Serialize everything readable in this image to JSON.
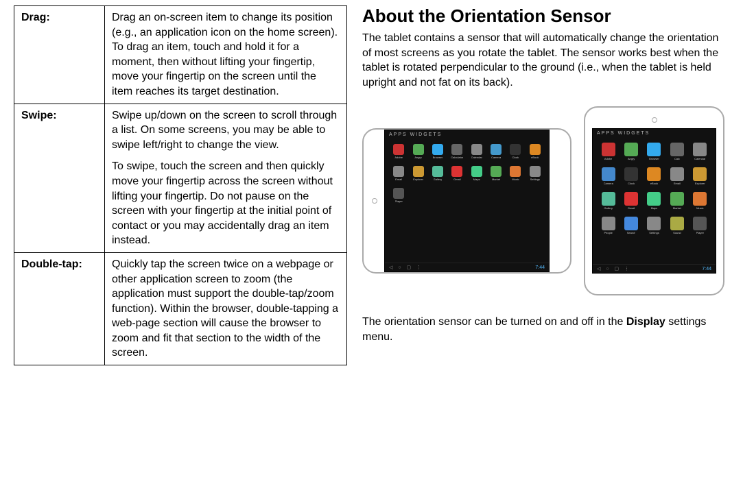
{
  "gestures": [
    {
      "label": "Drag:",
      "paragraphs": [
        "Drag an on-screen item to change its position (e.g., an application icon on the home screen).\nTo drag an item, touch and hold it for a moment, then without lifting your fingertip, move your fingertip on the screen until the item reaches its target destination."
      ]
    },
    {
      "label": "Swipe:",
      "paragraphs": [
        "Swipe up/down on the screen to scroll through a list. On some screens, you may be able to swipe left/right to change the view.",
        "To swipe, touch the screen and then quickly move your fingertip across the screen without lifting your fingertip. Do not pause on the screen with your fingertip at the initial point of contact or you may accidentally drag an item instead."
      ]
    },
    {
      "label": "Double-tap:",
      "paragraphs": [
        "Quickly tap the screen twice on a webpage or other application screen to zoom (the application must support the double-tap/zoom function). Within the browser, double-tapping a web-page section will cause the browser to zoom and fit that section to the width of the screen."
      ]
    }
  ],
  "heading": "About the Orientation Sensor",
  "intro": "The tablet contains a sensor that will automatically change the orientation of most screens as you rotate the tablet. The sensor works best when the tablet is rotated perpendicular to the ground (i.e., when the tablet is held upright and not fat on its back).",
  "screen_tabs": "APPS    WIDGETS",
  "time": "7:44",
  "landscape_apps": [
    {
      "name": "Adobe",
      "color": "#c33"
    },
    {
      "name": "Angry",
      "color": "#5a5"
    },
    {
      "name": "Browser",
      "color": "#3ae"
    },
    {
      "name": "Calculator",
      "color": "#666"
    },
    {
      "name": "Calendar",
      "color": "#888"
    },
    {
      "name": "Camera",
      "color": "#49c"
    },
    {
      "name": "Clock",
      "color": "#333"
    },
    {
      "name": "eBook",
      "color": "#d82"
    },
    {
      "name": "Email",
      "color": "#888"
    },
    {
      "name": "Explorer",
      "color": "#c93"
    },
    {
      "name": "Gallery",
      "color": "#5b9"
    },
    {
      "name": "Gmail",
      "color": "#d33"
    },
    {
      "name": "Maps",
      "color": "#4c8"
    },
    {
      "name": "Market",
      "color": "#5a5"
    },
    {
      "name": "Music",
      "color": "#d73"
    },
    {
      "name": "Settings",
      "color": "#888"
    },
    {
      "name": "Player",
      "color": "#555"
    }
  ],
  "portrait_apps": [
    {
      "name": "Adobe",
      "color": "#c33"
    },
    {
      "name": "Angry",
      "color": "#5a5"
    },
    {
      "name": "Browser",
      "color": "#3ae"
    },
    {
      "name": "Calc",
      "color": "#666"
    },
    {
      "name": "Calendar",
      "color": "#888"
    },
    {
      "name": "Camera",
      "color": "#48c"
    },
    {
      "name": "Clock",
      "color": "#333"
    },
    {
      "name": "eBook",
      "color": "#d82"
    },
    {
      "name": "Email",
      "color": "#888"
    },
    {
      "name": "Explorer",
      "color": "#c93"
    },
    {
      "name": "Gallery",
      "color": "#5b9"
    },
    {
      "name": "Gmail",
      "color": "#d33"
    },
    {
      "name": "Maps",
      "color": "#4c8"
    },
    {
      "name": "Market",
      "color": "#5a5"
    },
    {
      "name": "Music",
      "color": "#d73"
    },
    {
      "name": "People",
      "color": "#888"
    },
    {
      "name": "Search",
      "color": "#48d"
    },
    {
      "name": "Settings",
      "color": "#888"
    },
    {
      "name": "Sound",
      "color": "#aa4"
    },
    {
      "name": "Player",
      "color": "#555"
    }
  ],
  "outro_pre": "The orientation sensor can be turned on and off in the ",
  "outro_bold": "Display",
  "outro_post": " settings menu."
}
